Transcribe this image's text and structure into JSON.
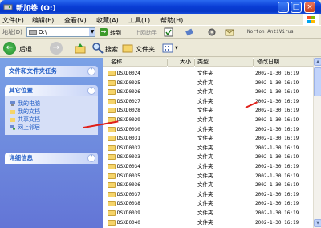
{
  "window": {
    "title": "新加卷 (O:)"
  },
  "menu": [
    "文件(F)",
    "编辑(E)",
    "查看(V)",
    "收藏(A)",
    "工具(T)",
    "帮助(H)"
  ],
  "address": {
    "label": "地址(D)",
    "value": "O:\\",
    "go_label": "转到",
    "links_label": "上网助手",
    "norton": "Norton AntiVirus"
  },
  "toolbar": {
    "back_label": "后退",
    "search_label": "搜索",
    "folders_label": "文件夹"
  },
  "sidebar": {
    "tasks_title": "文件和文件夹任务",
    "places_title": "其它位置",
    "places": [
      "我的电脑",
      "我的文档",
      "共享文档",
      "网上邻居"
    ],
    "details_title": "详细信息"
  },
  "columns": {
    "name": "名称",
    "size": "大小",
    "type": "类型",
    "date": "修改日期"
  },
  "files": [
    {
      "name": "DSXD0024",
      "type": "文件夹",
      "date": "2002-1-30 16:19"
    },
    {
      "name": "DSXD0025",
      "type": "文件夹",
      "date": "2002-1-30 16:19"
    },
    {
      "name": "DSXD0026",
      "type": "文件夹",
      "date": "2002-1-30 16:19"
    },
    {
      "name": "DSXD0027",
      "type": "文件夹",
      "date": "2002-1-30 16:19"
    },
    {
      "name": "DSXD0028",
      "type": "文件夹",
      "date": "2002-1-30 16:19"
    },
    {
      "name": "DSXD0029",
      "type": "文件夹",
      "date": "2002-1-30 16:19"
    },
    {
      "name": "DSXD0030",
      "type": "文件夹",
      "date": "2002-1-30 16:19"
    },
    {
      "name": "DSXD0031",
      "type": "文件夹",
      "date": "2002-1-30 16:19"
    },
    {
      "name": "DSXD0032",
      "type": "文件夹",
      "date": "2002-1-30 16:19"
    },
    {
      "name": "DSXD0033",
      "type": "文件夹",
      "date": "2002-1-30 16:19"
    },
    {
      "name": "DSXD0034",
      "type": "文件夹",
      "date": "2002-1-30 16:19"
    },
    {
      "name": "DSXD0035",
      "type": "文件夹",
      "date": "2002-1-30 16:19"
    },
    {
      "name": "DSXD0036",
      "type": "文件夹",
      "date": "2002-1-30 16:19"
    },
    {
      "name": "DSXD0037",
      "type": "文件夹",
      "date": "2002-1-30 16:19"
    },
    {
      "name": "DSXD0038",
      "type": "文件夹",
      "date": "2002-1-30 16:19"
    },
    {
      "name": "DSXD0039",
      "type": "文件夹",
      "date": "2002-1-30 16:19"
    },
    {
      "name": "DSXD0040",
      "type": "文件夹",
      "date": "2002-1-30 16:19"
    }
  ],
  "colors": {
    "title_blue": "#0a3ed6",
    "task_blue": "#215dc6",
    "annotation_red": "#e0201a",
    "folder_yellow": "#f5d46a"
  }
}
